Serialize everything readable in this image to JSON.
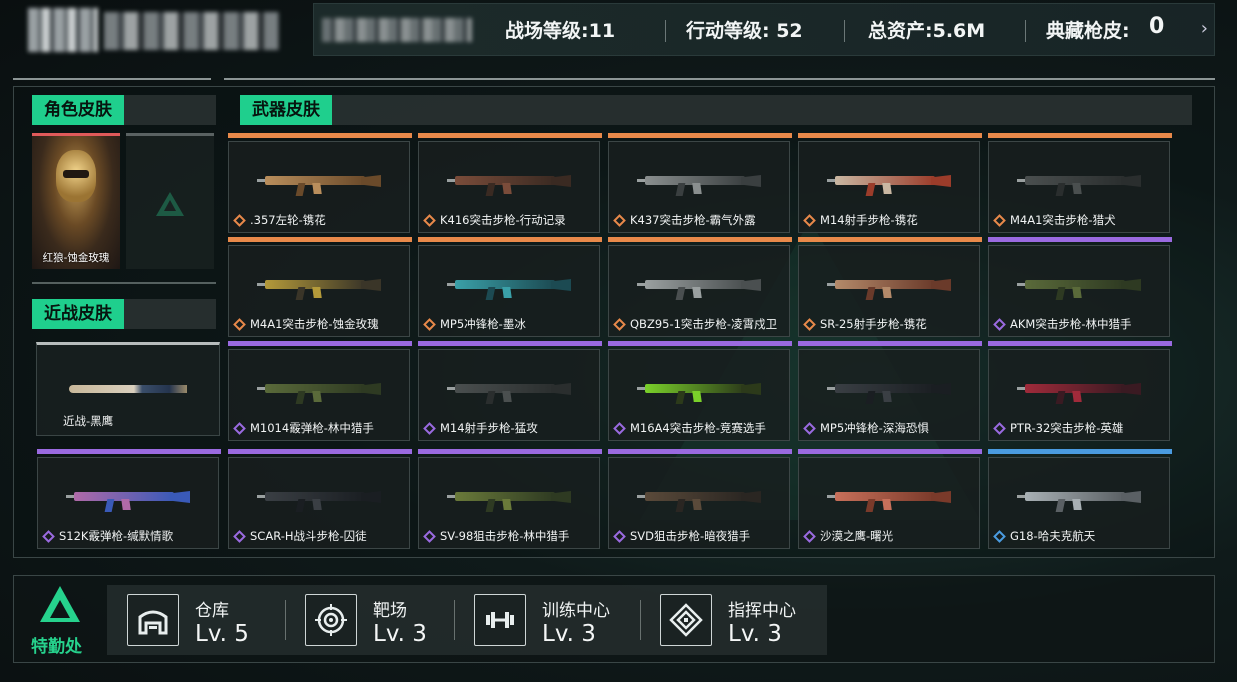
{
  "header": {
    "stats": [
      {
        "label": "战场等级:11"
      },
      {
        "label": "行动等级: 52"
      },
      {
        "label": "总资产:5.6M"
      },
      {
        "label": "典藏枪皮:"
      },
      {
        "label": "0"
      }
    ],
    "more_icon": "chevron-right-icon"
  },
  "sections": {
    "character": "角色皮肤",
    "weapon": "武器皮肤",
    "melee": "近战皮肤"
  },
  "character_skins": [
    {
      "label": "红狼-蚀金玫瑰",
      "rarity_color": "#e05a5a"
    }
  ],
  "melee_skins": [
    {
      "label": "近战-黑鹰",
      "rarity_color": "#b7bcbc"
    }
  ],
  "rarity_colors": {
    "orange": "#e8894a",
    "purple": "#9a6ae0",
    "blue": "#4a9be0"
  },
  "weapon_skins": [
    {
      "label": ".357左轮-镌花",
      "rarity": "orange"
    },
    {
      "label": "K416突击步枪-行动记录",
      "rarity": "orange"
    },
    {
      "label": "K437突击步枪-霸气外露",
      "rarity": "orange"
    },
    {
      "label": "M14射手步枪-镌花",
      "rarity": "orange"
    },
    {
      "label": "M4A1突击步枪-猎犬",
      "rarity": "orange"
    },
    {
      "label": "M4A1突击步枪-蚀金玫瑰",
      "rarity": "orange"
    },
    {
      "label": "MP5冲锋枪-墨冰",
      "rarity": "orange"
    },
    {
      "label": "QBZ95-1突击步枪-凌霄戍卫",
      "rarity": "orange"
    },
    {
      "label": "SR-25射手步枪-镌花",
      "rarity": "orange"
    },
    {
      "label": "AKM突击步枪-林中猎手",
      "rarity": "purple"
    },
    {
      "label": "M1014霰弹枪-林中猎手",
      "rarity": "purple"
    },
    {
      "label": "M14射手步枪-猛攻",
      "rarity": "purple"
    },
    {
      "label": "M16A4突击步枪-竞赛选手",
      "rarity": "purple"
    },
    {
      "label": "MP5冲锋枪-深海恐惧",
      "rarity": "purple"
    },
    {
      "label": "PTR-32突击步枪-英雄",
      "rarity": "purple"
    },
    {
      "label": "S12K霰弹枪-缄默情歌",
      "rarity": "purple"
    },
    {
      "label": "SCAR-H战斗步枪-囚徒",
      "rarity": "purple"
    },
    {
      "label": "SV-98狙击步枪-林中猎手",
      "rarity": "purple"
    },
    {
      "label": "SVD狙击步枪-暗夜猎手",
      "rarity": "purple"
    },
    {
      "label": "沙漠之鹰-曙光",
      "rarity": "purple"
    },
    {
      "label": "G18-哈夫克航天",
      "rarity": "blue"
    }
  ],
  "footer": {
    "logo_label": "特勤处",
    "facilities": [
      {
        "name": "仓库",
        "level": "Lv. 5",
        "icon": "warehouse-icon"
      },
      {
        "name": "靶场",
        "level": "Lv. 3",
        "icon": "target-icon"
      },
      {
        "name": "训练中心",
        "level": "Lv. 3",
        "icon": "dumbbell-icon"
      },
      {
        "name": "指挥中心",
        "level": "Lv. 3",
        "icon": "command-emblem-icon"
      }
    ]
  }
}
